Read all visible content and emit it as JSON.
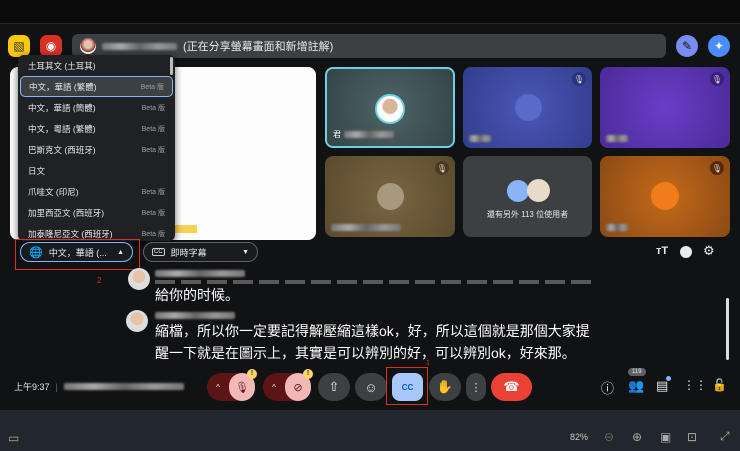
{
  "presenter_bar": {
    "status": "(正在分享螢幕畫面和新增註解)"
  },
  "language_menu": {
    "items": [
      {
        "label": "土耳其文 (土耳其)",
        "badge": ""
      },
      {
        "label": "中文，華語 (繁體)",
        "badge": "Beta 版",
        "selected": true
      },
      {
        "label": "中文，華語 (簡體)",
        "badge": "Beta 版"
      },
      {
        "label": "中文，粵語 (繁體)",
        "badge": "Beta 版"
      },
      {
        "label": "巴斯克文 (西班牙)",
        "badge": "Beta 版"
      },
      {
        "label": "日文",
        "badge": ""
      },
      {
        "label": "爪哇文 (印尼)",
        "badge": "Beta 版"
      },
      {
        "label": "加里西亞文 (西班牙)",
        "badge": "Beta 版"
      },
      {
        "label": "加泰隆尼亞文 (西班牙)",
        "badge": "Beta 版"
      }
    ]
  },
  "participants": {
    "first_tile_name_prefix": "君",
    "others_label": "還有另外 113 位使用者"
  },
  "caption_bar": {
    "language_button": "中文，華語 (...",
    "captions_select": "即時字幕",
    "annotation": "2"
  },
  "captions": [
    {
      "text": "給你的时候。"
    },
    {
      "text": "縮檔，所以你一定要記得解壓縮這樣ok，好，所以這個就是那個大家提醒一下就是在圖示上，其實是可以辨別的好，可以辨別ok，好來那。"
    }
  ],
  "bottom": {
    "time": "上午9:37",
    "participant_count": "119",
    "annotation": "1"
  },
  "browser_bar": {
    "zoom": "82%"
  },
  "colors": {
    "accent": "#8ab4f8",
    "end_call": "#ea4335",
    "mic_off": "#f2b8b5",
    "highlight_box": "#d93025"
  }
}
